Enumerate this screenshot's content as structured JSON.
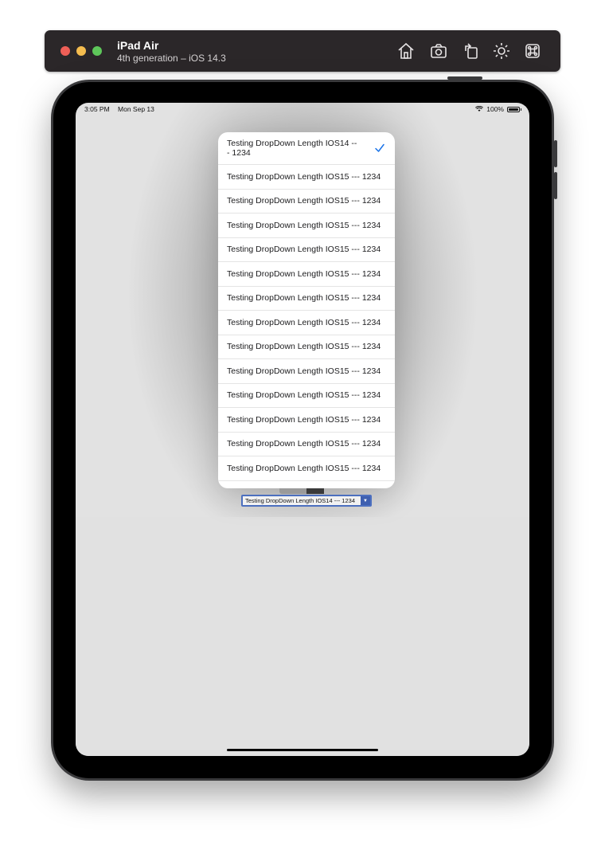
{
  "simulator": {
    "device_name": "iPad Air",
    "device_detail": "4th generation – iOS 14.3",
    "toolbar_icons": [
      "home-icon",
      "screenshot-icon",
      "rotate-icon",
      "appearance-icon",
      "command-icon"
    ]
  },
  "status_bar": {
    "time": "3:05 PM",
    "date": "Mon Sep 13",
    "battery": "100%"
  },
  "dropdown": {
    "selected_index": 0,
    "options": [
      "Testing DropDown Length IOS14 --- 1234",
      "Testing DropDown Length IOS15 --- 1234",
      "Testing DropDown Length IOS15 --- 1234",
      "Testing DropDown Length IOS15 --- 1234",
      "Testing DropDown Length IOS15 --- 1234",
      "Testing DropDown Length IOS15 --- 1234",
      "Testing DropDown Length IOS15 --- 1234",
      "Testing DropDown Length IOS15 --- 1234",
      "Testing DropDown Length IOS15 --- 1234",
      "Testing DropDown Length IOS15 --- 1234",
      "Testing DropDown Length IOS15 --- 1234",
      "Testing DropDown Length IOS15 --- 1234",
      "Testing DropDown Length IOS15 --- 1234",
      "Testing DropDown Length IOS15 --- 1234"
    ]
  },
  "select": {
    "value": "Testing DropDown Length IOS14 --- 1234",
    "arrow": "▼"
  },
  "colors": {
    "accent": "#1a73e8",
    "select_border": "#4c6fbf"
  }
}
